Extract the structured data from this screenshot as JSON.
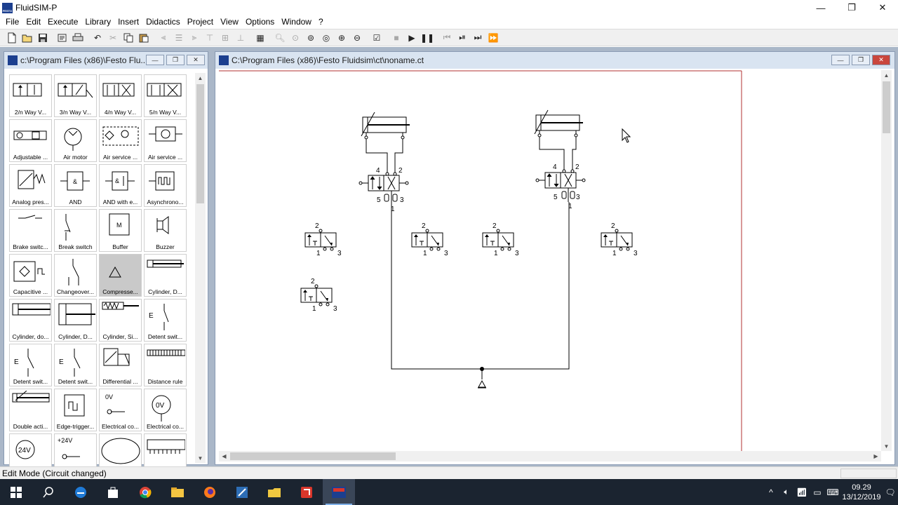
{
  "app": {
    "title": "FluidSIM-P",
    "logo_text": "FESTO"
  },
  "window_controls": {
    "minimize": "—",
    "restore": "❐",
    "close": "✕"
  },
  "menu": [
    "File",
    "Edit",
    "Execute",
    "Library",
    "Insert",
    "Didactics",
    "Project",
    "View",
    "Options",
    "Window",
    "?"
  ],
  "library_window": {
    "title": "c:\\Program Files (x86)\\Festo Flu...",
    "items": [
      {
        "label": "2/n Way V...",
        "icon": "valve-2n-icon"
      },
      {
        "label": "3/n Way V...",
        "icon": "valve-3n-icon"
      },
      {
        "label": "4/n Way V...",
        "icon": "valve-4n-icon"
      },
      {
        "label": "5/n Way V...",
        "icon": "valve-5n-icon"
      },
      {
        "label": "Adjustable ...",
        "icon": "adjustable-valve-icon"
      },
      {
        "label": "Air motor",
        "icon": "air-motor-icon"
      },
      {
        "label": "Air service ...",
        "icon": "air-service-unit-icon"
      },
      {
        "label": "Air service ...",
        "icon": "air-service-simplified-icon"
      },
      {
        "label": "Analog pres...",
        "icon": "analog-pressure-icon"
      },
      {
        "label": "AND",
        "icon": "and-gate-icon"
      },
      {
        "label": "AND with e...",
        "icon": "and-extended-icon"
      },
      {
        "label": "Asynchrono...",
        "icon": "async-counter-icon"
      },
      {
        "label": "Brake switc...",
        "icon": "brake-switch-icon"
      },
      {
        "label": "Break switch",
        "icon": "break-switch-icon"
      },
      {
        "label": "Buffer",
        "icon": "buffer-icon"
      },
      {
        "label": "Buzzer",
        "icon": "buzzer-icon"
      },
      {
        "label": "Capacitive ...",
        "icon": "capacitive-sensor-icon"
      },
      {
        "label": "Changeover...",
        "icon": "changeover-switch-icon"
      },
      {
        "label": "Compresse...",
        "icon": "compressed-air-supply-icon",
        "selected": true
      },
      {
        "label": "Cylinder, D...",
        "icon": "cylinder-double-icon"
      },
      {
        "label": "Cylinder, do...",
        "icon": "cylinder-double-rod-icon"
      },
      {
        "label": "Cylinder, D...",
        "icon": "cylinder-double-2-icon"
      },
      {
        "label": "Cylinder, Si...",
        "icon": "cylinder-single-icon"
      },
      {
        "label": "Detent swit...",
        "icon": "detent-switch-icon"
      },
      {
        "label": "Detent swit...",
        "icon": "detent-switch-no-icon"
      },
      {
        "label": "Detent swit...",
        "icon": "detent-switch-nc-icon"
      },
      {
        "label": "Differential ...",
        "icon": "differential-pressure-icon"
      },
      {
        "label": "Distance rule",
        "icon": "distance-rule-icon"
      },
      {
        "label": "Double acti...",
        "icon": "double-acting-cylinder-icon"
      },
      {
        "label": "Edge-trigger...",
        "icon": "edge-trigger-icon"
      },
      {
        "label": "Electrical co...",
        "icon": "electrical-connection-0v-icon",
        "text": "0V"
      },
      {
        "label": "Electrical co...",
        "icon": "electrical-connection-0v-round-icon",
        "text": "0V"
      },
      {
        "label": "",
        "icon": "supply-24v-icon",
        "text": "24V"
      },
      {
        "label": "",
        "icon": "electrical-connection-24v-icon",
        "text": "+24V"
      },
      {
        "label": "",
        "icon": "ellipse-icon"
      },
      {
        "label": "",
        "icon": "terminal-strip-icon"
      }
    ]
  },
  "circuit_window": {
    "title": "C:\\Program Files (x86)\\Festo Fluidsim\\ct\\noname.ct",
    "port_labels": {
      "p1": "1",
      "p2": "2",
      "p3": "3",
      "p4": "4",
      "p5": "5"
    }
  },
  "status": {
    "text": "Edit Mode (Circuit changed)"
  },
  "taskbar": {
    "apps": [
      "windows-start-icon",
      "search-icon",
      "edge-icon",
      "store-icon",
      "chrome-icon",
      "file-explorer-icon",
      "firefox-icon",
      "fluidsim-pen-icon",
      "folder-icon",
      "red-app-icon",
      "fluidsim-festo-icon"
    ],
    "clock_time": "09.29",
    "clock_date": "13/12/2019"
  },
  "colors": {
    "mdi_background": "#aab7c8",
    "canvas_border": "#b03030",
    "taskbar": "#1b2430"
  }
}
